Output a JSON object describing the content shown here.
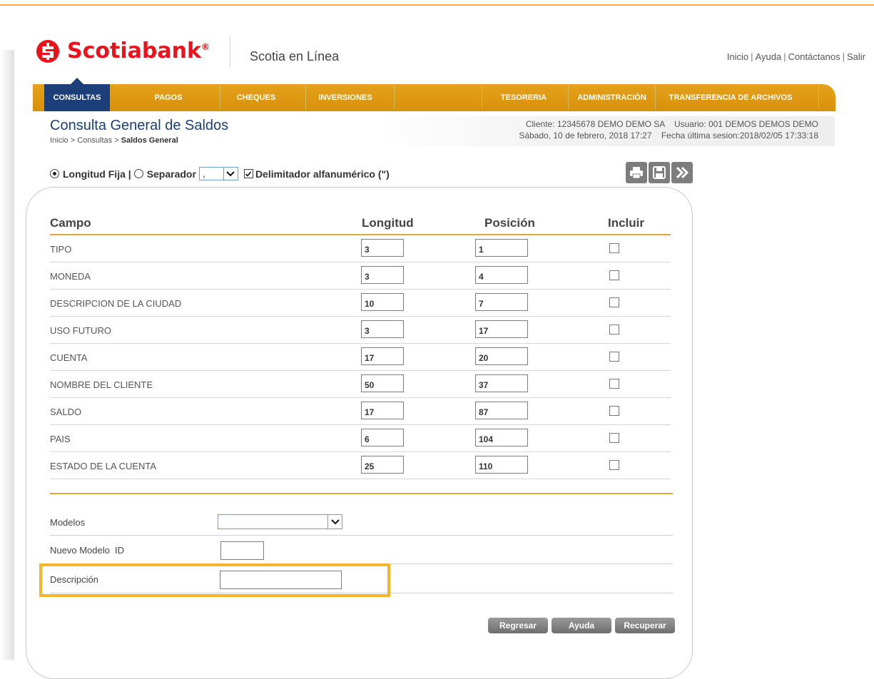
{
  "header": {
    "brand": "Scotiabank",
    "registered_mark": "®",
    "product": "Scotia en Línea",
    "links": [
      "Inicio",
      "Ayuda",
      "Contáctanos",
      "Salir"
    ],
    "brand_color": "#ec111a"
  },
  "nav": {
    "items": [
      "CONSULTAS",
      "PAGOS",
      "CHEQUES",
      "INVERSIONES",
      "TESORERIA",
      "ADMINISTRACIÓN",
      "TRANSFERENCIA DE ARCHIVOS"
    ],
    "active": "CONSULTAS",
    "accent_color": "#df9812",
    "active_color": "#1c3f7a"
  },
  "page": {
    "title": "Consulta General de Saldos",
    "breadcrumb_prefix": "Inicio > Consultas > ",
    "breadcrumb_current": "Saldos General",
    "client_line": "Cliente: 12345678 DEMO DEMO SA    Usuario: 001 DEMOS DEMOS DEMO",
    "date_line": "Sábado, 10 de febrero, 2018 17:27    Fecha última sesion:2018/02/05 17:33:18"
  },
  "options": {
    "fixed_label": "Longitud Fija |",
    "separator_label": "Separador",
    "separator_value": ",",
    "delimiter_label": "Delimitador alfanumérico (\")",
    "fixed_selected": true,
    "delimiter_checked": true
  },
  "toolbar": {
    "icons": [
      "print-icon",
      "save-icon",
      "forward-icon"
    ]
  },
  "table": {
    "headers": {
      "campo": "Campo",
      "longitud": "Longitud",
      "posicion": "Posición",
      "incluir": "Incluir"
    },
    "rows": [
      {
        "campo": "TIPO",
        "longitud": "3",
        "posicion": "1"
      },
      {
        "campo": "MONEDA",
        "longitud": "3",
        "posicion": "4"
      },
      {
        "campo": "DESCRIPCION DE LA CIUDAD",
        "longitud": "10",
        "posicion": "7"
      },
      {
        "campo": "USO FUTURO",
        "longitud": "3",
        "posicion": "17"
      },
      {
        "campo": "CUENTA",
        "longitud": "17",
        "posicion": "20"
      },
      {
        "campo": "NOMBRE DEL CLIENTE",
        "longitud": "50",
        "posicion": "37"
      },
      {
        "campo": "SALDO",
        "longitud": "17",
        "posicion": "87"
      },
      {
        "campo": "PAIS",
        "longitud": "6",
        "posicion": "104"
      },
      {
        "campo": "ESTADO DE LA CUENTA",
        "longitud": "25",
        "posicion": "110"
      }
    ]
  },
  "form": {
    "modelos_label": "Modelos",
    "nuevo_modelo_label": "Nuevo Modelo  ID",
    "descripcion_label": "Descripción",
    "modelos_value": "",
    "nuevo_modelo_value": "",
    "descripcion_value": ""
  },
  "buttons": {
    "regresar": "Regresar",
    "ayuda": "Ayuda",
    "recuperar": "Recuperar"
  },
  "highlight_color": "#f4b52d"
}
